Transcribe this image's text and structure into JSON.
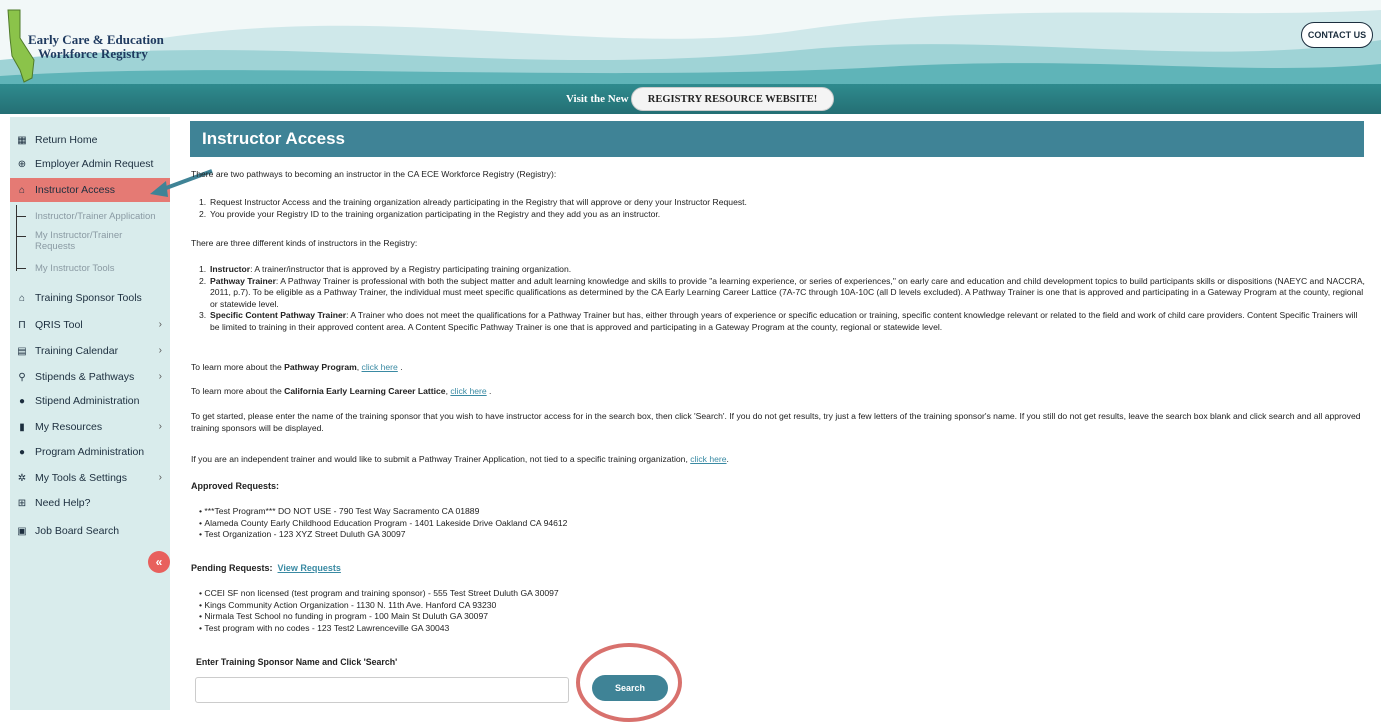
{
  "header": {
    "logo_line1": "Early Care & Education",
    "logo_line2": "Workforce Registry",
    "contact_label": "CONTACT US",
    "banner_text": "Visit the New",
    "banner_button": "REGISTRY RESOURCE WEBSITE!"
  },
  "sidebar": {
    "items": [
      {
        "label": "Return Home",
        "icon": "grid-icon"
      },
      {
        "label": "Employer Admin Request",
        "icon": "globe-icon"
      },
      {
        "label": "Instructor Access",
        "icon": "school-icon"
      },
      {
        "label": "Training Sponsor Tools",
        "icon": "school-icon"
      },
      {
        "label": "QRIS Tool",
        "icon": "building-icon"
      },
      {
        "label": "Training Calendar",
        "icon": "calendar-icon"
      },
      {
        "label": "Stipends & Pathways",
        "icon": "search-icon"
      },
      {
        "label": "Stipend Administration",
        "icon": "user-icon"
      },
      {
        "label": "My Resources",
        "icon": "file-icon"
      },
      {
        "label": "Program Administration",
        "icon": "user-icon"
      },
      {
        "label": "My Tools & Settings",
        "icon": "gears-icon"
      },
      {
        "label": "Need Help?",
        "icon": "plus-box-icon"
      },
      {
        "label": "Job Board Search",
        "icon": "card-icon"
      }
    ],
    "sub_items": [
      {
        "label": "Instructor/Trainer Application"
      },
      {
        "label": "My Instructor/Trainer Requests"
      },
      {
        "label": "My Instructor Tools"
      }
    ],
    "collapse_label": "«"
  },
  "main": {
    "title": "Instructor Access",
    "intro": "There are two pathways to becoming an instructor in the CA ECE Workforce Registry (Registry):",
    "pathways": [
      "Request Instructor Access and the training organization already participating in the Registry that will approve or deny your Instructor Request.",
      "You provide your Registry ID to the training organization participating in the Registry and they add you as an instructor."
    ],
    "kinds_intro": "There are three different kinds of instructors in the Registry:",
    "kinds": [
      {
        "term": "Instructor",
        "text": ": A trainer/instructor that is approved by a Registry participating training organization."
      },
      {
        "term": "Pathway Trainer",
        "text": ": A Pathway Trainer is professional with both the subject matter and adult learning knowledge and skills to provide \"a learning experience, or series of experiences,\" on early care and education and child development topics to build participants skills or dispositions (NAEYC and NACCRA, 2011, p.7). To be eligible as a Pathway Trainer, the individual must meet specific qualifications as determined by the CA Early Learning Career Lattice (7A-7C through 10A-10C (all D levels excluded). A Pathway Trainer is one that is approved and participating in a Gateway Program at the county, regional or statewide level."
      },
      {
        "term": "Specific Content Pathway Trainer",
        "text": ": A Trainer who does not meet the qualifications for a Pathway Trainer but has, either through years of experience or specific education or training, specific content knowledge relevant or related to the field and work of child care providers. Content Specific Trainers will be limited to training in their approved content area. A Content Specific Pathway Trainer is one that is approved and participating in a Gateway Program at the county, regional or statewide level."
      }
    ],
    "learn_pathway_pre": "To learn more about the ",
    "learn_pathway_bold": "Pathway Program",
    "learn_pathway_link": "click here",
    "learn_lattice_pre": "To learn more about the ",
    "learn_lattice_bold": "California Early Learning Career Lattice",
    "learn_lattice_link": "click here",
    "get_started": "To get started, please enter the name of the training sponsor that you wish to have instructor access for in the search box, then click 'Search'. If you do not get results, try just a few letters of the training sponsor's name. If you still do not get results, leave the search box blank and click search and all approved training sponsors will be displayed.",
    "independent_pre": "If you are an independent trainer and would like to submit a Pathway Trainer Application, not tied to a specific training organization, ",
    "independent_link": "click here",
    "approved_heading": "Approved Requests:",
    "approved": [
      "***Test Program*** DO NOT USE - 790 Test Way Sacramento CA 01889",
      "Alameda County Early Childhood Education Program - 1401 Lakeside Drive Oakland CA 94612",
      "Test Organization - 123 XYZ Street Duluth GA 30097"
    ],
    "pending_heading": "Pending Requests:",
    "pending_link": "View Requests",
    "pending": [
      "CCEI SF non licensed (test program and training sponsor) - 555 Test Street Duluth GA 30097",
      "Kings Community Action Organization - 1130 N. 11th Ave. Hanford CA 93230",
      "Nirmala Test School no funding in program - 100 Main St Duluth GA 30097",
      "Test program with no codes - 123 Test2 Lawrenceville GA 30043"
    ],
    "search_label": "Enter Training Sponsor Name and Click 'Search'",
    "search_value": "",
    "search_button": "Search"
  },
  "colors": {
    "teal": "#3f8396",
    "active": "#e57a74",
    "sidebar_bg": "#d9ecec",
    "link": "#3a8aa3"
  }
}
